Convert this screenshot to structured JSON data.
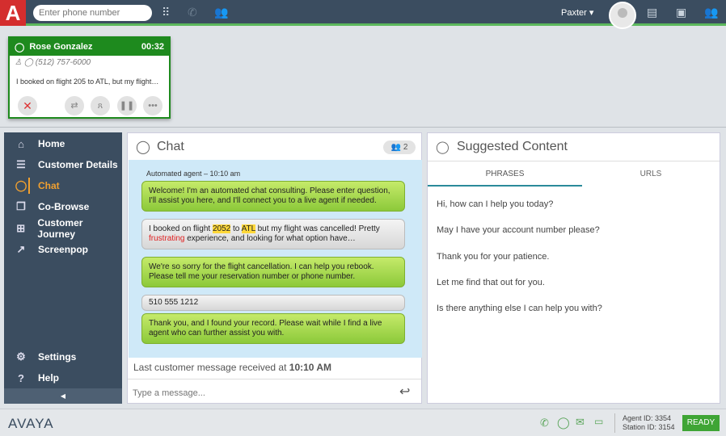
{
  "topbar": {
    "logo": "A",
    "phone_placeholder": "Enter phone number",
    "user": "Paxter ▾",
    "icons": [
      "dialpad-icon",
      "phone-icon",
      "add-contact-icon",
      "notes-icon",
      "contact-card-icon",
      "team-icon"
    ]
  },
  "call_card": {
    "name": "Rose Gonzalez",
    "timer": "00:32",
    "phone": "(512) 757-6000",
    "preview": "I booked on flight 205 to ATL, but my flight…",
    "color": "#1e8a1e"
  },
  "sidebar": {
    "items": [
      {
        "label": "Home",
        "icon": "⌂"
      },
      {
        "label": "Customer Details",
        "icon": "☰"
      },
      {
        "label": "Chat",
        "icon": "◯"
      },
      {
        "label": "Co-Browse",
        "icon": "❐"
      },
      {
        "label": "Customer Journey",
        "icon": "⊞"
      },
      {
        "label": "Screenpop",
        "icon": "↗"
      }
    ],
    "bottom": [
      {
        "label": "Settings",
        "icon": "⚙"
      },
      {
        "label": "Help",
        "icon": "?"
      }
    ],
    "collapse": "◀"
  },
  "chat": {
    "title": "Chat",
    "participants": "2",
    "agent_label": "Automated agent – 10:10 am",
    "m1": "Welcome! I'm an automated chat consulting. Please enter question, I'll assist you here, and I'll connect you to a live agent if needed.",
    "m2a": "I booked on flight ",
    "m2b": "2052",
    "m2c": " to ",
    "m2d": "ATL",
    "m2e": " but my flight was cancelled! Pretty ",
    "m2f": "frustrating",
    "m2g": " experience, and looking for what option  have…",
    "m3": "We're so sorry for the flight cancellation. I can help you rebook. Please tell me your reservation number or phone number.",
    "m4": "510 555 1212",
    "m5": "Thank you, and I found your record. Please wait while I find a live agent who can further assist you with.",
    "last_label": "Last customer message received at ",
    "last_time": "10:10 AM",
    "input_placeholder": "Type a message...",
    "send": "↩"
  },
  "suggested": {
    "title": "Suggested Content",
    "tabs": [
      "PHRASES",
      "URLS"
    ],
    "phrases": [
      "Hi, how can I help you today?",
      "May I have your account number please?",
      "Thank you for your patience.",
      "Let me find that out for you.",
      "Is there anything else I can help you with?"
    ]
  },
  "footer": {
    "brand": "AVAYA",
    "agent_id": "Agent ID: 3354",
    "station_id": "Station ID: 3154",
    "status": "READY",
    "status_color": "#3fa535"
  }
}
